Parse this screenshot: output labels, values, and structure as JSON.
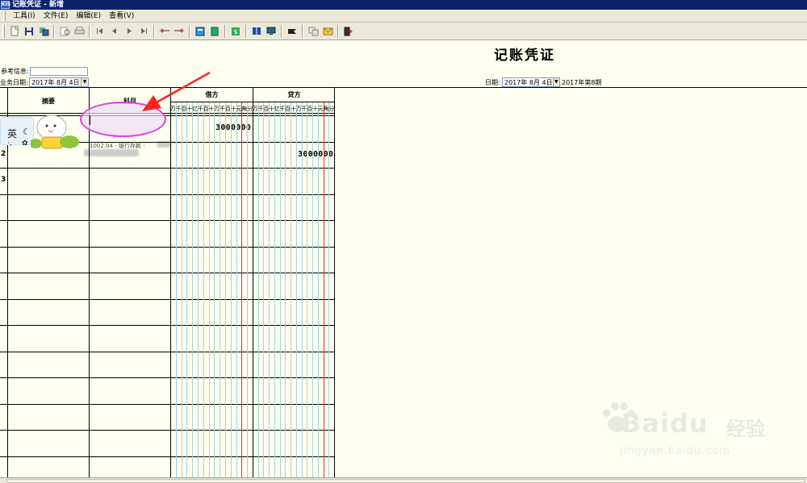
{
  "window": {
    "title": "记账凭证 - 新增",
    "app_icon": "KIS"
  },
  "menu": [
    {
      "label": "工具(I)"
    },
    {
      "label": "文件(E)"
    },
    {
      "label": "编辑(E)"
    },
    {
      "label": "查看(V)"
    }
  ],
  "toolbar_icons": [
    "new-icon",
    "save-icon",
    "copy-icon",
    "preview-icon",
    "print-icon",
    "first-icon",
    "prev-icon",
    "next-icon",
    "last-icon",
    "insert-row-icon",
    "delete-row-icon",
    "calc-icon",
    "balance-icon",
    "cash-flow-icon",
    "book-icon",
    "monitor-icon",
    "flag-icon",
    "attach-icon",
    "mail-icon",
    "exit-icon"
  ],
  "voucher": {
    "title": "记账凭证",
    "ref_label": "参考信息:",
    "ref_value": "",
    "bizdate_label": "业务日期:",
    "bizdate_value": "2017年 8月 4日",
    "date_label": "日期:",
    "date_value": "2017年 8月 4日",
    "period_text": "2017年第8期"
  },
  "grid": {
    "col_summary": "摘要",
    "col_account": "科目",
    "col_debit": "借方",
    "col_credit": "贷方",
    "digits": [
      "万",
      "千",
      "百",
      "十",
      "亿",
      "千",
      "百",
      "十",
      "万",
      "千",
      "百",
      "十",
      "元",
      "角",
      "分"
    ],
    "rows": [
      {
        "num": "",
        "debit": "3000000",
        "credit": "",
        "account": ""
      },
      {
        "num": "2",
        "debit": "",
        "credit": "3000000",
        "account": "1002.04 - 银行存款 - "
      },
      {
        "num": "3",
        "debit": "",
        "credit": "",
        "account": ""
      }
    ]
  },
  "ime": {
    "lang_char": "英"
  },
  "watermark": {
    "brand": "Baidu",
    "cn": "经验",
    "url": "jingyan.baidu.com"
  },
  "colors": {
    "titlebar": "#0a246a",
    "highlight": "#e040e0",
    "arrow": "#ff2020",
    "grid_line": "#000000",
    "digit_line": "#a8d0d8",
    "yuan_line": "#e03030"
  }
}
